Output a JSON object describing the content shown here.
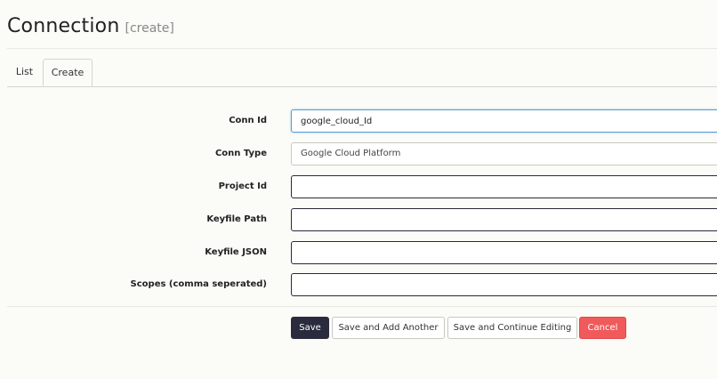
{
  "header": {
    "title": "Connection",
    "subtitle": "[create]"
  },
  "tabs": [
    {
      "label": "List",
      "active": false
    },
    {
      "label": "Create",
      "active": true
    }
  ],
  "form": {
    "conn_id": {
      "label": "Conn Id",
      "value": "google_cloud_Id"
    },
    "conn_type": {
      "label": "Conn Type",
      "value": "Google Cloud Platform"
    },
    "project_id": {
      "label": "Project Id",
      "value": ""
    },
    "keyfile_path": {
      "label": "Keyfile Path",
      "value": ""
    },
    "keyfile_json": {
      "label": "Keyfile JSON",
      "value": ""
    },
    "scopes": {
      "label": "Scopes (comma seperated)",
      "value": ""
    }
  },
  "buttons": {
    "save": "Save",
    "save_add": "Save and Add Another",
    "save_continue": "Save and Continue Editing",
    "cancel": "Cancel"
  },
  "colors": {
    "primary": "#2a2c3d",
    "danger": "#f05a5a",
    "focus": "#5b9bd5"
  }
}
